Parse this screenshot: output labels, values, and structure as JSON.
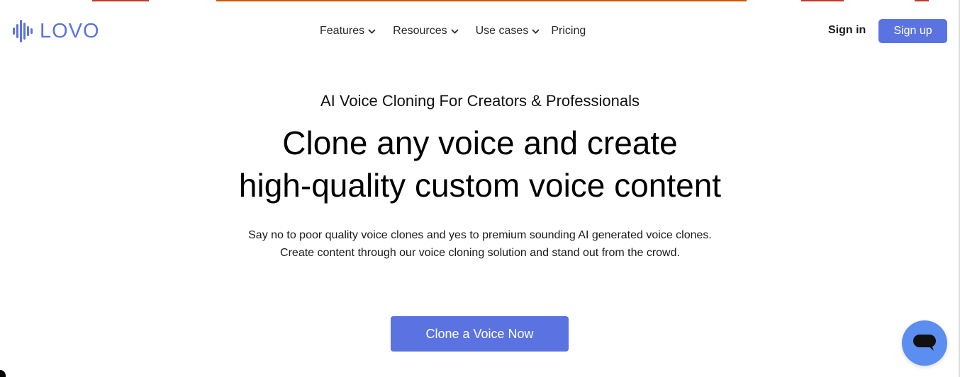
{
  "brand": {
    "name": "LOVO",
    "color": "#5b73e0"
  },
  "nav": {
    "items": [
      {
        "label": "Features",
        "icon": "chevron-down-icon"
      },
      {
        "label": "Resources",
        "icon": "chevron-down-icon"
      },
      {
        "label": "Use cases",
        "icon": "chevron-down-icon"
      },
      {
        "label": "Pricing"
      }
    ]
  },
  "auth": {
    "sign_in_label": "Sign in",
    "sign_up_label": "Sign up"
  },
  "hero": {
    "eyebrow": "AI Voice Cloning For Creators & Professionals",
    "headline_line1": "Clone any voice and create",
    "headline_line2": "high-quality custom voice content",
    "subtext_line1": "Say no to poor quality voice clones and yes to premium sounding AI generated voice clones.",
    "subtext_line2": "Create content through our voice cloning solution and stand out from the crowd.",
    "cta_label": "Clone a Voice Now"
  },
  "chat_widget": {
    "icon": "chat-bubble-icon",
    "color": "#5b8ef0"
  },
  "colors": {
    "accent": "#5b73e0"
  }
}
